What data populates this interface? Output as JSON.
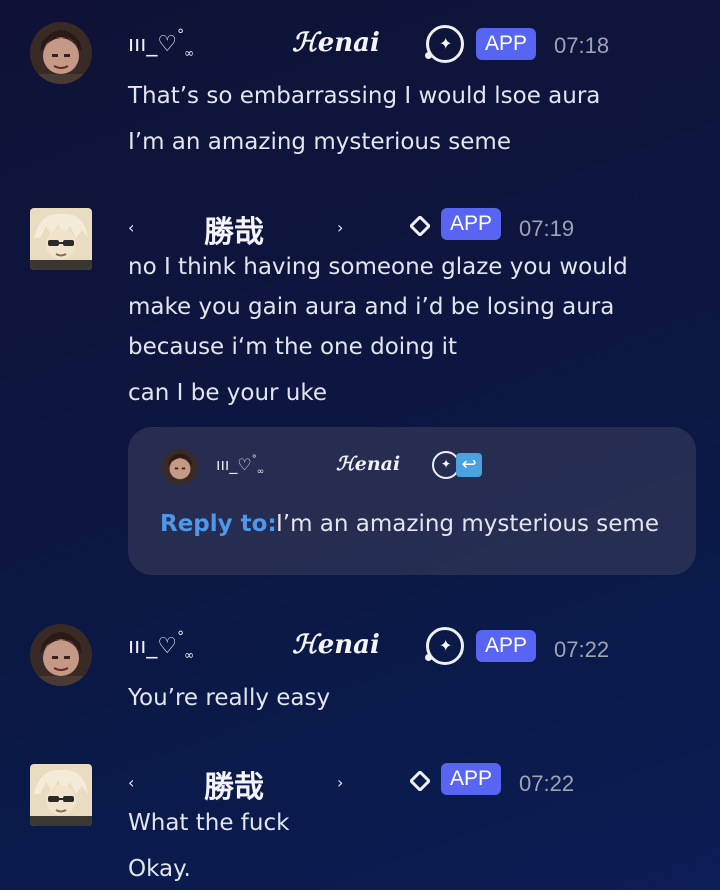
{
  "users": {
    "kenai": {
      "prefix": "ııı_♡",
      "prefix_ring": "°",
      "prefix_inf": "∞",
      "display_name": "ℋenai"
    },
    "katsuya": {
      "left_mark": "‹",
      "display_name": "勝哉",
      "right_mark": "›"
    }
  },
  "badges": {
    "app_label": "APP"
  },
  "messages": [
    {
      "author": "kenai",
      "time": "07:18",
      "lines": [
        "That’s so embarrassing I would lsoe aura",
        "I’m an amazing mysterious seme"
      ]
    },
    {
      "author": "katsuya",
      "time": "07:19",
      "lines": [
        "no I think having someone glaze you would",
        "make you gain aura and i’d be losing aura",
        "because i‘m the one doing it",
        "can I be your uke"
      ]
    },
    {
      "author": "kenai",
      "time": "07:22",
      "lines": [
        "You’re really easy"
      ]
    },
    {
      "author": "katsuya",
      "time": "07:22",
      "lines": [
        "What the fuck",
        "Okay."
      ]
    }
  ],
  "reply_card": {
    "label": "Reply to:",
    "text": "I’m an amazing mysterious seme",
    "return_symbol": "↩"
  },
  "colors": {
    "accent": "#5865f2",
    "reply_label": "#4f97e8",
    "background_top": "#0f1236",
    "background_bottom": "#0b1d55"
  }
}
